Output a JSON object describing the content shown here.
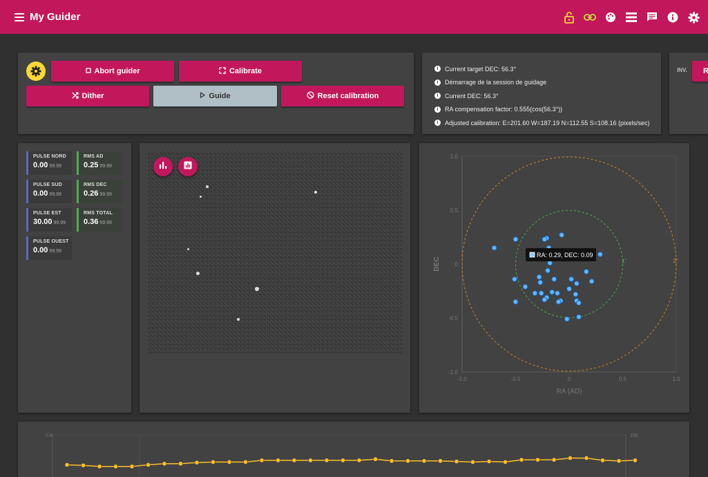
{
  "app": {
    "title": "My Guider"
  },
  "toolbar": {
    "actions": [
      "lock-open-icon",
      "link-icon",
      "palette-icon",
      "list-icon",
      "chat-icon",
      "info-icon",
      "settings-icon"
    ],
    "lock_color": "#fdd835",
    "link_color": "#cddc39"
  },
  "controls": {
    "abort": "Abort guider",
    "calibrate": "Calibrate",
    "dither": "Dither",
    "guide": "Guide",
    "reset": "Reset calibration"
  },
  "log": {
    "entries": [
      "Current target DEC: 56.3°",
      "Démarrage de la session de guidage",
      "Current DEC: 56.3°",
      "RA compensation factor: 0.555(cos(56.3°))",
      "Adjusted calibration: E=201.60 W=187.19 N=112.55 S=108.16 (pixels/sec)"
    ]
  },
  "side_card": {
    "label": "INV.",
    "button": "R"
  },
  "stats": {
    "pulse_nord": {
      "label": "PULSE NORD",
      "value": "0.00",
      "max": "99.99"
    },
    "pulse_sud": {
      "label": "PULSE SUD",
      "value": "0.00",
      "max": "99.99"
    },
    "pulse_est": {
      "label": "PULSE EST",
      "value": "30.00",
      "max": "99.99"
    },
    "pulse_ouest": {
      "label": "PULSE OUEST",
      "value": "0.00",
      "max": "99.99"
    },
    "rms_ad": {
      "label": "RMS AD",
      "value": "0.25",
      "max": "99.99"
    },
    "rms_dec": {
      "label": "RMS DEC",
      "value": "0.26",
      "max": "99.99"
    },
    "rms_total": {
      "label": "RMS TOTAL",
      "value": "0.36",
      "max": "99.99"
    }
  },
  "scatter": {
    "xlabel": "RA (AD)",
    "ylabel": "DEC",
    "x_ticks": [
      "-1.0",
      "-0.5",
      "0",
      "0.5",
      "1.0"
    ],
    "y_ticks": [
      "1.0",
      "0.5",
      "0",
      "-0.5",
      "-1.0"
    ],
    "ring1_label": "1\"",
    "ring2_label": "2\"",
    "ring1_color": "#4caf50",
    "ring2_color": "#c8862a",
    "tooltip": "RA: 0.29, DEC: 0.09"
  },
  "bottom_chart": {
    "y_left_top": "0.4",
    "y_right_top": "100",
    "line_color": "#fbc02d"
  },
  "chart_data": [
    {
      "type": "scatter",
      "xlabel": "RA (AD)",
      "ylabel": "DEC",
      "xlim": [
        -1.0,
        1.0
      ],
      "ylim": [
        -1.0,
        1.0
      ],
      "points": [
        {
          "x": -0.07,
          "y": 0.27
        },
        {
          "x": -0.21,
          "y": 0.24
        },
        {
          "x": -0.23,
          "y": 0.23
        },
        {
          "x": -0.5,
          "y": 0.23
        },
        {
          "x": -0.7,
          "y": 0.15
        },
        {
          "x": -0.19,
          "y": 0.15
        },
        {
          "x": -0.23,
          "y": 0.11
        },
        {
          "x": 0.29,
          "y": 0.09
        },
        {
          "x": 0.09,
          "y": 0.08
        },
        {
          "x": -0.18,
          "y": 0.01
        },
        {
          "x": -0.2,
          "y": -0.06
        },
        {
          "x": 0.16,
          "y": -0.07
        },
        {
          "x": -0.28,
          "y": -0.12
        },
        {
          "x": -0.51,
          "y": -0.14
        },
        {
          "x": -0.14,
          "y": -0.14
        },
        {
          "x": 0.02,
          "y": -0.14
        },
        {
          "x": 0.21,
          "y": -0.16
        },
        {
          "x": -0.27,
          "y": -0.17
        },
        {
          "x": 0.07,
          "y": -0.18
        },
        {
          "x": -0.41,
          "y": -0.21
        },
        {
          "x": 0.0,
          "y": -0.23
        },
        {
          "x": -0.16,
          "y": -0.26
        },
        {
          "x": -0.32,
          "y": -0.27
        },
        {
          "x": -0.26,
          "y": -0.27
        },
        {
          "x": -0.11,
          "y": -0.27
        },
        {
          "x": 0.06,
          "y": -0.28
        },
        {
          "x": -0.21,
          "y": -0.31
        },
        {
          "x": -0.23,
          "y": -0.33
        },
        {
          "x": -0.08,
          "y": -0.34
        },
        {
          "x": 0.07,
          "y": -0.34
        },
        {
          "x": -0.1,
          "y": -0.35
        },
        {
          "x": 0.09,
          "y": -0.36
        },
        {
          "x": -0.5,
          "y": -0.35
        },
        {
          "x": 0.09,
          "y": -0.49
        },
        {
          "x": -0.02,
          "y": -0.51
        }
      ]
    },
    {
      "type": "line",
      "y_right_top": "100",
      "ylim": [
        0,
        100
      ],
      "series": [
        {
          "values": [
            2,
            1,
            -1,
            -1,
            -1,
            2,
            4,
            4,
            6,
            7,
            7,
            7,
            10,
            10,
            10,
            10,
            10,
            10,
            10,
            12,
            9,
            9,
            9,
            9,
            8,
            7,
            8,
            7,
            11,
            11,
            11,
            14,
            14,
            10,
            9,
            10
          ]
        }
      ]
    }
  ]
}
